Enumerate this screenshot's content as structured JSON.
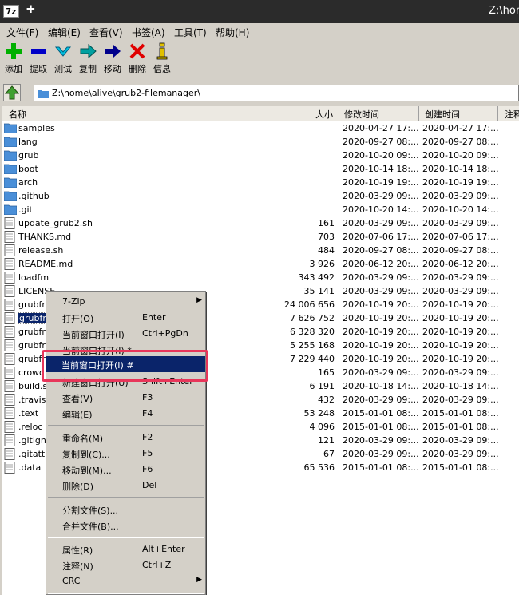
{
  "window": {
    "logo": "7z",
    "title": "Z:\\hom"
  },
  "menu": [
    "文件(F)",
    "编辑(E)",
    "查看(V)",
    "书签(A)",
    "工具(T)",
    "帮助(H)"
  ],
  "toolbar": [
    {
      "label": "添加",
      "icon": "add-plus-icon",
      "color": "#00b000"
    },
    {
      "label": "提取",
      "icon": "extract-minus-icon",
      "color": "#0000c8"
    },
    {
      "label": "测试",
      "icon": "test-check-icon",
      "color": "#00a0c8"
    },
    {
      "label": "复制",
      "icon": "copy-arrow-icon",
      "color": "#008c8c"
    },
    {
      "label": "移动",
      "icon": "move-arrow-icon",
      "color": "#00008c"
    },
    {
      "label": "删除",
      "icon": "delete-x-icon",
      "color": "#e00000"
    },
    {
      "label": "信息",
      "icon": "info-icon",
      "color": "#e0c000"
    }
  ],
  "address": {
    "path": "Z:\\home\\alive\\grub2-filemanager\\"
  },
  "columns": {
    "name": "名称",
    "size": "大小",
    "modified": "修改时间",
    "created": "创建时间",
    "comment": "注释"
  },
  "files": [
    {
      "name": "samples",
      "type": "folder",
      "size": "",
      "modified": "2020-04-27 17:...",
      "created": "2020-04-27 17:..."
    },
    {
      "name": "lang",
      "type": "folder",
      "size": "",
      "modified": "2020-09-27 08:...",
      "created": "2020-09-27 08:..."
    },
    {
      "name": "grub",
      "type": "folder",
      "size": "",
      "modified": "2020-10-20 09:...",
      "created": "2020-10-20 09:..."
    },
    {
      "name": "boot",
      "type": "folder",
      "size": "",
      "modified": "2020-10-14 18:...",
      "created": "2020-10-14 18:..."
    },
    {
      "name": "arch",
      "type": "folder",
      "size": "",
      "modified": "2020-10-19 19:...",
      "created": "2020-10-19 19:..."
    },
    {
      "name": ".github",
      "type": "folder",
      "size": "",
      "modified": "2020-03-29 09:...",
      "created": "2020-03-29 09:..."
    },
    {
      "name": ".git",
      "type": "folder",
      "size": "",
      "modified": "2020-10-20 14:...",
      "created": "2020-10-20 14:..."
    },
    {
      "name": "update_grub2.sh",
      "type": "file",
      "size": "161",
      "modified": "2020-03-29 09:...",
      "created": "2020-03-29 09:..."
    },
    {
      "name": "THANKS.md",
      "type": "file",
      "size": "703",
      "modified": "2020-07-06 17:...",
      "created": "2020-07-06 17:..."
    },
    {
      "name": "release.sh",
      "type": "file",
      "size": "484",
      "modified": "2020-09-27 08:...",
      "created": "2020-09-27 08:..."
    },
    {
      "name": "README.md",
      "type": "file",
      "size": "3 926",
      "modified": "2020-06-12 20:...",
      "created": "2020-06-12 20:..."
    },
    {
      "name": "loadfm",
      "type": "file",
      "size": "343 492",
      "modified": "2020-03-29 09:...",
      "created": "2020-03-29 09:..."
    },
    {
      "name": "LICENSE",
      "type": "file",
      "size": "35 141",
      "modified": "2020-03-29 09:...",
      "created": "2020-03-29 09:..."
    },
    {
      "name": "grubfr",
      "type": "file",
      "size": "24 006 656",
      "modified": "2020-10-19 20:...",
      "created": "2020-10-19 20:..."
    },
    {
      "name": "grubfm",
      "type": "file",
      "size": "7 626 752",
      "modified": "2020-10-19 20:...",
      "created": "2020-10-19 20:...",
      "selected": true
    },
    {
      "name": "grubfr",
      "type": "file",
      "size": "6 328 320",
      "modified": "2020-10-19 20:...",
      "created": "2020-10-19 20:..."
    },
    {
      "name": "grubfr",
      "type": "file",
      "size": "5 255 168",
      "modified": "2020-10-19 20:...",
      "created": "2020-10-19 20:..."
    },
    {
      "name": "grubfr",
      "type": "file",
      "size": "7 229 440",
      "modified": "2020-10-19 20:...",
      "created": "2020-10-19 20:..."
    },
    {
      "name": "crowd",
      "type": "file",
      "size": "165",
      "modified": "2020-03-29 09:...",
      "created": "2020-03-29 09:..."
    },
    {
      "name": "build.s",
      "type": "file",
      "size": "6 191",
      "modified": "2020-10-18 14:...",
      "created": "2020-10-18 14:..."
    },
    {
      "name": ".travis.",
      "type": "file",
      "size": "432",
      "modified": "2020-03-29 09:...",
      "created": "2020-03-29 09:..."
    },
    {
      "name": ".text",
      "type": "file",
      "size": "53 248",
      "modified": "2015-01-01 08:...",
      "created": "2015-01-01 08:..."
    },
    {
      "name": ".reloc",
      "type": "file",
      "size": "4 096",
      "modified": "2015-01-01 08:...",
      "created": "2015-01-01 08:..."
    },
    {
      "name": ".gitign",
      "type": "file",
      "size": "121",
      "modified": "2020-03-29 09:...",
      "created": "2020-03-29 09:..."
    },
    {
      "name": ".gitattr",
      "type": "file",
      "size": "67",
      "modified": "2020-03-29 09:...",
      "created": "2020-03-29 09:..."
    },
    {
      "name": ".data",
      "type": "file",
      "size": "65 536",
      "modified": "2015-01-01 08:...",
      "created": "2015-01-01 08:..."
    }
  ],
  "context_menu": [
    {
      "label": "7-Zip",
      "shortcut": "",
      "submenu": true
    },
    {
      "label": "打开(O)",
      "shortcut": "Enter"
    },
    {
      "label": "当前窗口打开(I)",
      "shortcut": "Ctrl+PgDn"
    },
    {
      "label": "当前窗口打开(I) *",
      "shortcut": ""
    },
    {
      "label": "当前窗口打开(I) #",
      "shortcut": ""
    },
    {
      "label": "新建窗口打开(U)",
      "shortcut": "Shift+Enter"
    },
    {
      "label": "查看(V)",
      "shortcut": "F3"
    },
    {
      "label": "编辑(E)",
      "shortcut": "F4"
    },
    {
      "separator": true
    },
    {
      "label": "重命名(M)",
      "shortcut": "F2"
    },
    {
      "label": "复制到(C)...",
      "shortcut": "F5"
    },
    {
      "label": "移动到(M)...",
      "shortcut": "F6"
    },
    {
      "label": "删除(D)",
      "shortcut": "Del"
    },
    {
      "separator": true
    },
    {
      "label": "分割文件(S)...",
      "shortcut": ""
    },
    {
      "label": "合并文件(B)...",
      "shortcut": ""
    },
    {
      "separator": true
    },
    {
      "label": "属性(R)",
      "shortcut": "Alt+Enter"
    },
    {
      "label": "注释(N)",
      "shortcut": "Ctrl+Z"
    },
    {
      "label": "CRC",
      "shortcut": "",
      "submenu": true
    },
    {
      "separator": true
    }
  ],
  "highlighted_item": {
    "label": "当前窗口打开(I) #"
  },
  "colors": {
    "selection": "#0a246a",
    "highlight_box": "#e8365a",
    "folder": "#4a8fd8"
  }
}
